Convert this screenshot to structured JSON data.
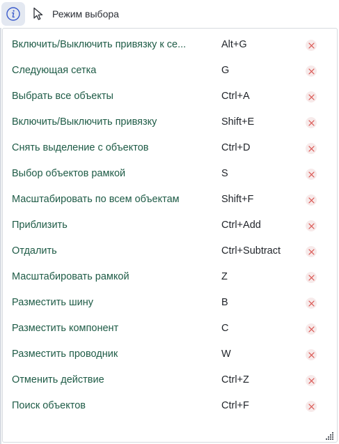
{
  "toolbar": {
    "info_icon": "info-circle-icon",
    "cursor_icon": "arrow-pointer-icon",
    "mode_label": "Режим выбора"
  },
  "shortcuts": [
    {
      "command": "Включить/Выключить привязку к се...",
      "key": "Alt+G"
    },
    {
      "command": "Следующая сетка",
      "key": "G"
    },
    {
      "command": "Выбрать все объекты",
      "key": "Ctrl+A"
    },
    {
      "command": "Включить/Выключить привязку",
      "key": "Shift+E"
    },
    {
      "command": "Снять выделение с объектов",
      "key": "Ctrl+D"
    },
    {
      "command": "Выбор объектов рамкой",
      "key": "S"
    },
    {
      "command": "Масштабировать по всем объектам",
      "key": "Shift+F"
    },
    {
      "command": "Приблизить",
      "key": "Ctrl+Add"
    },
    {
      "command": "Отдалить",
      "key": "Ctrl+Subtract"
    },
    {
      "command": "Масштабировать рамкой",
      "key": "Z"
    },
    {
      "command": "Разместить шину",
      "key": "B"
    },
    {
      "command": "Разместить компонент",
      "key": "C"
    },
    {
      "command": "Разместить проводник",
      "key": "W"
    },
    {
      "command": "Отменить действие",
      "key": "Ctrl+Z"
    },
    {
      "command": "Поиск объектов",
      "key": "Ctrl+F"
    }
  ],
  "colors": {
    "command_text": "#1e5b46",
    "key_text": "#1f2329",
    "delete_icon": "#d9534f",
    "info_accent": "#3b5bcc"
  },
  "delete_icon": "close-x-icon",
  "resize_icon": "resize-grip-icon"
}
